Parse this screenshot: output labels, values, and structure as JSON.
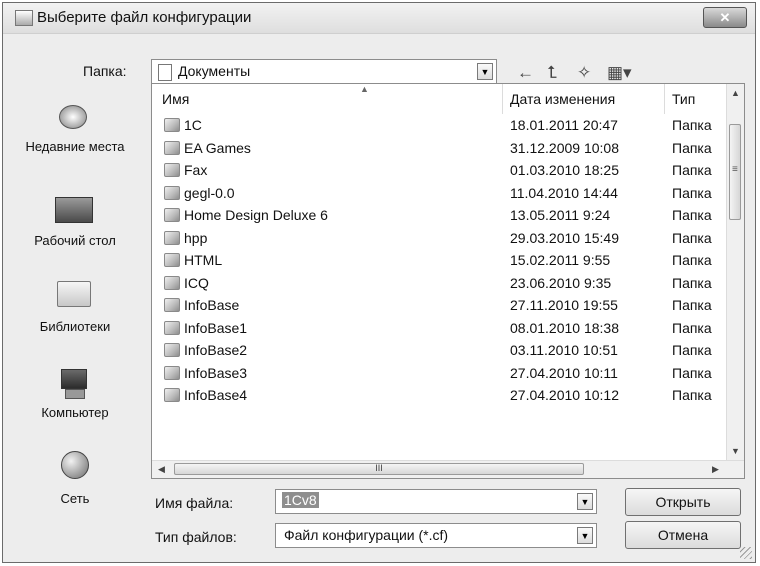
{
  "window": {
    "title": "Выберите файл конфигурации",
    "close_glyph": "✕"
  },
  "toolbar": {
    "folder_label": "Папка:",
    "folder_value": "Документы",
    "back_icon": "←",
    "up_icon": "⮤",
    "new_folder_icon": "✧",
    "views_icon": "▦▾"
  },
  "places": [
    {
      "label": "Недавние места",
      "icon": "recent-places-icon"
    },
    {
      "label": "Рабочий стол",
      "icon": "desktop-icon"
    },
    {
      "label": "Библиотеки",
      "icon": "libraries-icon"
    },
    {
      "label": "Компьютер",
      "icon": "computer-icon"
    },
    {
      "label": "Сеть",
      "icon": "network-icon"
    }
  ],
  "columns": {
    "name": "Имя",
    "date": "Дата изменения",
    "type": "Тип"
  },
  "files": [
    {
      "name": "1C",
      "date": "18.01.2011 20:47",
      "type": "Папка"
    },
    {
      "name": "EA Games",
      "date": "31.12.2009 10:08",
      "type": "Папка"
    },
    {
      "name": "Fax",
      "date": "01.03.2010 18:25",
      "type": "Папка"
    },
    {
      "name": "gegl-0.0",
      "date": "11.04.2010 14:44",
      "type": "Папка"
    },
    {
      "name": "Home Design Deluxe 6",
      "date": "13.05.2011 9:24",
      "type": "Папка"
    },
    {
      "name": "hpp",
      "date": "29.03.2010 15:49",
      "type": "Папка"
    },
    {
      "name": "HTML",
      "date": "15.02.2011 9:55",
      "type": "Папка"
    },
    {
      "name": "ICQ",
      "date": "23.06.2010 9:35",
      "type": "Папка"
    },
    {
      "name": "InfoBase",
      "date": "27.11.2010 19:55",
      "type": "Папка"
    },
    {
      "name": "InfoBase1",
      "date": "08.01.2010 18:38",
      "type": "Папка"
    },
    {
      "name": "InfoBase2",
      "date": "03.11.2010 10:51",
      "type": "Папка"
    },
    {
      "name": "InfoBase3",
      "date": "27.04.2010 10:11",
      "type": "Папка"
    },
    {
      "name": "InfoBase4",
      "date": "27.04.2010 10:12",
      "type": "Папка"
    }
  ],
  "file_name": {
    "label": "Имя файла:",
    "value": "1Cv8"
  },
  "file_type": {
    "label": "Тип файлов:",
    "value": "Файл конфигурации (*.cf)"
  },
  "buttons": {
    "open": "Открыть",
    "cancel": "Отмена"
  },
  "colors": {
    "window_bg": "#ededed",
    "selection": "#3399ff"
  }
}
